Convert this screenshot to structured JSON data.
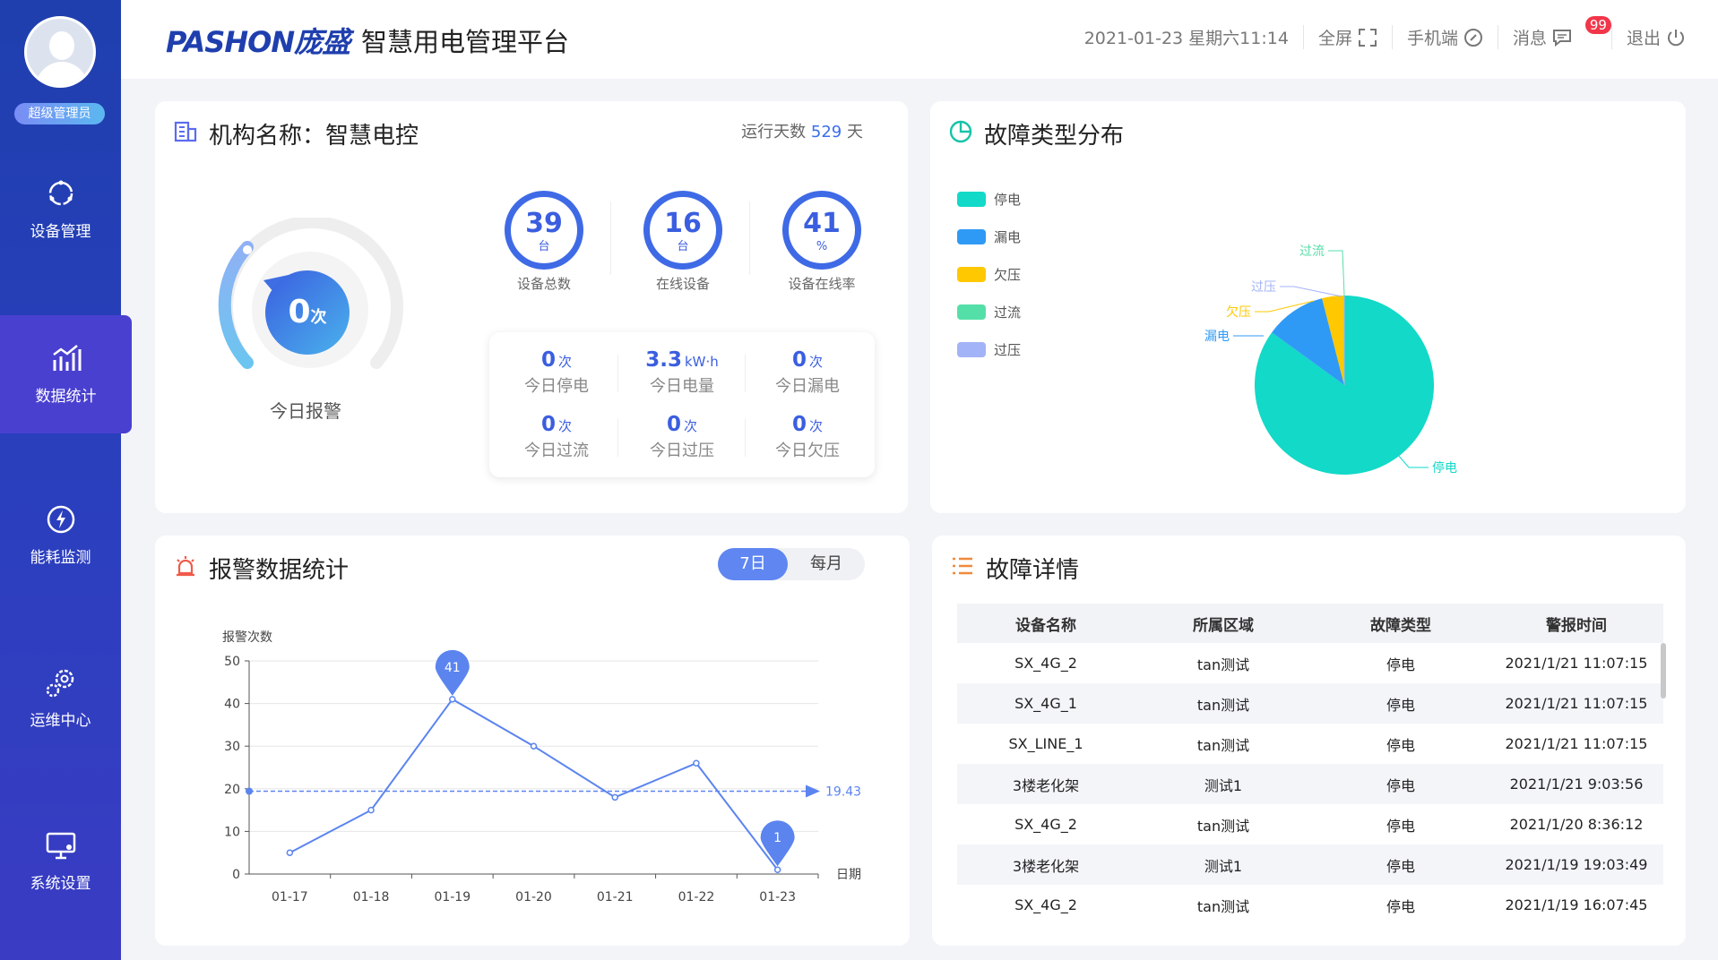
{
  "sidebar": {
    "role": "超级管理员",
    "items": [
      {
        "label": "设备管理",
        "icon": "loop-icon"
      },
      {
        "label": "数据统计",
        "icon": "chart-icon"
      },
      {
        "label": "能耗监测",
        "icon": "bolt-icon"
      },
      {
        "label": "运维中心",
        "icon": "gears-icon"
      },
      {
        "label": "系统设置",
        "icon": "monitor-icon"
      }
    ]
  },
  "header": {
    "logo": "PASHON庞盛",
    "title": "智慧用电管理平台",
    "datetime": "2021-01-23 星期六11:14",
    "fullscreen": "全屏",
    "mobile": "手机端",
    "messages": "消息",
    "message_count": "99",
    "logout": "退出"
  },
  "org_card": {
    "title": "机构名称：智慧电控",
    "run_days_prefix": "运行天数",
    "run_days": "529",
    "run_days_suffix": "天",
    "alarm_today_value": "0",
    "alarm_today_unit": "次",
    "alarm_today_label": "今日报警",
    "rings": [
      {
        "value": "39",
        "unit": "台",
        "label": "设备总数"
      },
      {
        "value": "16",
        "unit": "台",
        "label": "在线设备"
      },
      {
        "value": "41",
        "unit": "%",
        "label": "设备在线率"
      }
    ],
    "stats": [
      {
        "value": "0",
        "unit": "次",
        "label": "今日停电"
      },
      {
        "value": "3.3",
        "unit": "kW·h",
        "label": "今日电量"
      },
      {
        "value": "0",
        "unit": "次",
        "label": "今日漏电"
      },
      {
        "value": "0",
        "unit": "次",
        "label": "今日过流"
      },
      {
        "value": "0",
        "unit": "次",
        "label": "今日过压"
      },
      {
        "value": "0",
        "unit": "次",
        "label": "今日欠压"
      }
    ]
  },
  "fault_dist": {
    "title": "故障类型分布",
    "legend": [
      {
        "label": "停电",
        "color": "#12d9c8"
      },
      {
        "label": "漏电",
        "color": "#2f9af5"
      },
      {
        "label": "欠压",
        "color": "#ffc800"
      },
      {
        "label": "过流",
        "color": "#55dfa8"
      },
      {
        "label": "过压",
        "color": "#a3b3f7"
      }
    ]
  },
  "alarm_stats": {
    "title": "报警数据统计",
    "tab_week": "7日",
    "tab_month": "每月"
  },
  "fault_details": {
    "title": "故障详情",
    "columns": [
      "设备名称",
      "所属区域",
      "故障类型",
      "警报时间"
    ],
    "rows": [
      [
        "SX_4G_2",
        "tan测试",
        "停电",
        "2021/1/21 11:07:15"
      ],
      [
        "SX_4G_1",
        "tan测试",
        "停电",
        "2021/1/21 11:07:15"
      ],
      [
        "SX_LINE_1",
        "tan测试",
        "停电",
        "2021/1/21 11:07:15"
      ],
      [
        "3楼老化架",
        "测试1",
        "停电",
        "2021/1/21 9:03:56"
      ],
      [
        "SX_4G_2",
        "tan测试",
        "停电",
        "2021/1/20 8:36:12"
      ],
      [
        "3楼老化架",
        "测试1",
        "停电",
        "2021/1/19 19:03:49"
      ],
      [
        "SX_4G_2",
        "tan测试",
        "停电",
        "2021/1/19 16:07:45"
      ]
    ]
  },
  "chart_data": [
    {
      "type": "pie",
      "labels": [
        "停电",
        "漏电",
        "欠压",
        "过流",
        "过压"
      ],
      "values": [
        85,
        11,
        4,
        0,
        0
      ],
      "colors": [
        "#12d9c8",
        "#2f9af5",
        "#ffc800",
        "#55dfa8",
        "#a3b3f7"
      ]
    },
    {
      "type": "line",
      "xlabel": "日期",
      "ylabel": "报警次数",
      "categories": [
        "01-17",
        "01-18",
        "01-19",
        "01-20",
        "01-21",
        "01-22",
        "01-23"
      ],
      "values": [
        5,
        15,
        41,
        30,
        18,
        26,
        1
      ],
      "ylim": [
        0,
        50
      ],
      "yticks": [
        0,
        10,
        20,
        30,
        40,
        50
      ],
      "average": 19.43,
      "average_label": "19.43",
      "max_label": "41",
      "min_label": "1",
      "color": "#5b84ef"
    }
  ]
}
